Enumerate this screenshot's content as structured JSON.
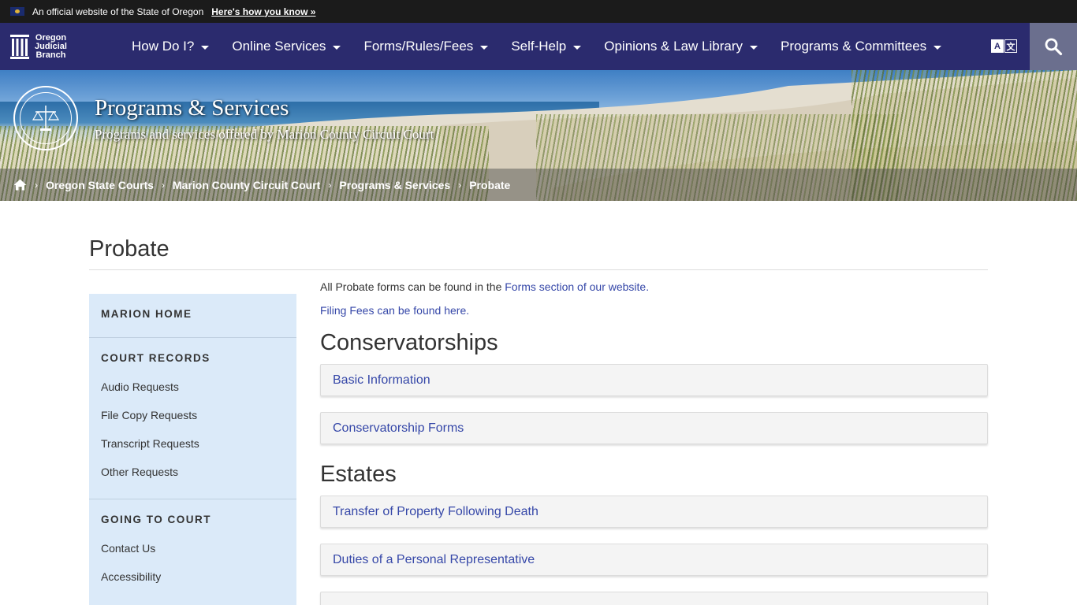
{
  "gov_banner": {
    "text": "An official website of the State of Oregon",
    "link": "Here's how you know »"
  },
  "nav": {
    "logo_lines": [
      "Oregon",
      "Judicial",
      "Branch"
    ],
    "items": [
      {
        "label": "How Do I?"
      },
      {
        "label": "Online Services"
      },
      {
        "label": "Forms/Rules/Fees"
      },
      {
        "label": "Self-Help"
      },
      {
        "label": "Opinions & Law Library"
      },
      {
        "label": "Programs & Committees"
      }
    ],
    "translate_a": "A",
    "translate_b": "文"
  },
  "hero": {
    "title": "Programs & Services",
    "subtitle": "Programs and services offered by Marion County Circuit Court"
  },
  "breadcrumb": {
    "items": [
      "Oregon State Courts",
      "Marion County Circuit Court",
      "Programs & Services"
    ],
    "current": "Probate"
  },
  "page": {
    "title": "Probate"
  },
  "sidebar": {
    "home": "MARION HOME",
    "records_head": "COURT RECORDS",
    "records": [
      "Audio Requests",
      "File Copy Requests",
      "Transcript Requests",
      "Other Requests"
    ],
    "going_head": "GOING TO COURT",
    "going": [
      "Contact Us",
      "Accessibility"
    ]
  },
  "main": {
    "forms_text": "All Probate forms can be found in the ",
    "forms_link": "Forms section of our website.",
    "fees_link": "Filing Fees can be found here.",
    "conservatorships_title": "Conservatorships",
    "conservatorships": [
      "Basic Information",
      "Conservatorship Forms"
    ],
    "estates_title": "Estates",
    "estates": [
      "Transfer of Property Following Death",
      "Duties of a Personal Representative",
      ""
    ]
  },
  "colors": {
    "nav_bg": "#2b2b6e",
    "link": "#3547a8",
    "sidebar_bg": "#dbeaf9"
  }
}
